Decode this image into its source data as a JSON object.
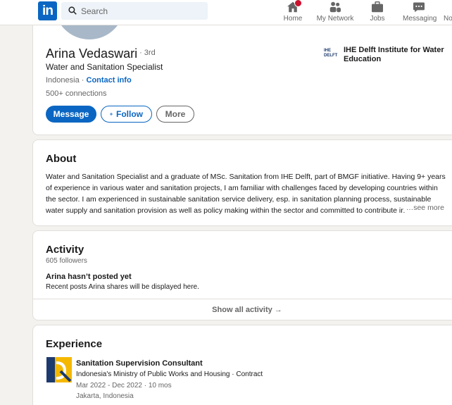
{
  "nav": {
    "logo_text": "in",
    "search_placeholder": "Search",
    "items": [
      {
        "label": "Home",
        "icon": "home-icon"
      },
      {
        "label": "My Network",
        "icon": "network-icon"
      },
      {
        "label": "Jobs",
        "icon": "jobs-icon"
      },
      {
        "label": "Messaging",
        "icon": "messaging-icon"
      },
      {
        "label": "No",
        "icon": "notifications-icon"
      }
    ]
  },
  "profile": {
    "name": "Arina Vedaswari",
    "degree": "· 3rd",
    "headline": "Water and Sanitation Specialist",
    "location": "Indonesia",
    "location_sep": " · ",
    "contact_label": "Contact info",
    "connections": "500+ connections",
    "message_label": "Message",
    "follow_label": "Follow",
    "more_label": "More",
    "education": "IHE Delft Institute for Water Education",
    "education_logo_text": "IHE DELFT"
  },
  "about": {
    "title": "About",
    "text": "Water and Sanitation Specialist and a graduate of MSc. Sanitation from IHE Delft, part of BMGF initiative. Having 9+ years of experience in various water and sanitation projects, I am familiar with challenges faced by developing countries within the sector. I am experienced in sustainable sanitation service delivery, esp. in sanitation planning process, sustainable water supply and sanitation provision as well as policy making within the sector and committed to contribute in",
    "see_more": "…see more"
  },
  "activity": {
    "title": "Activity",
    "followers": "605 followers",
    "empty_title": "Arina hasn’t posted yet",
    "empty_sub": "Recent posts Arina shares will be displayed here.",
    "show_all": "Show all activity →"
  },
  "experience": {
    "title": "Experience",
    "items": [
      {
        "title": "Sanitation Supervision Consultant",
        "company": "Indonesia's Ministry of Public Works and Housing · Contract",
        "dates": "Mar 2022 - Dec 2022 · 10 mos",
        "location": "Jakarta, Indonesia"
      }
    ]
  },
  "colors": {
    "brand": "#0a66c2",
    "badge": "#cb112d",
    "background": "#f4f2ee"
  }
}
